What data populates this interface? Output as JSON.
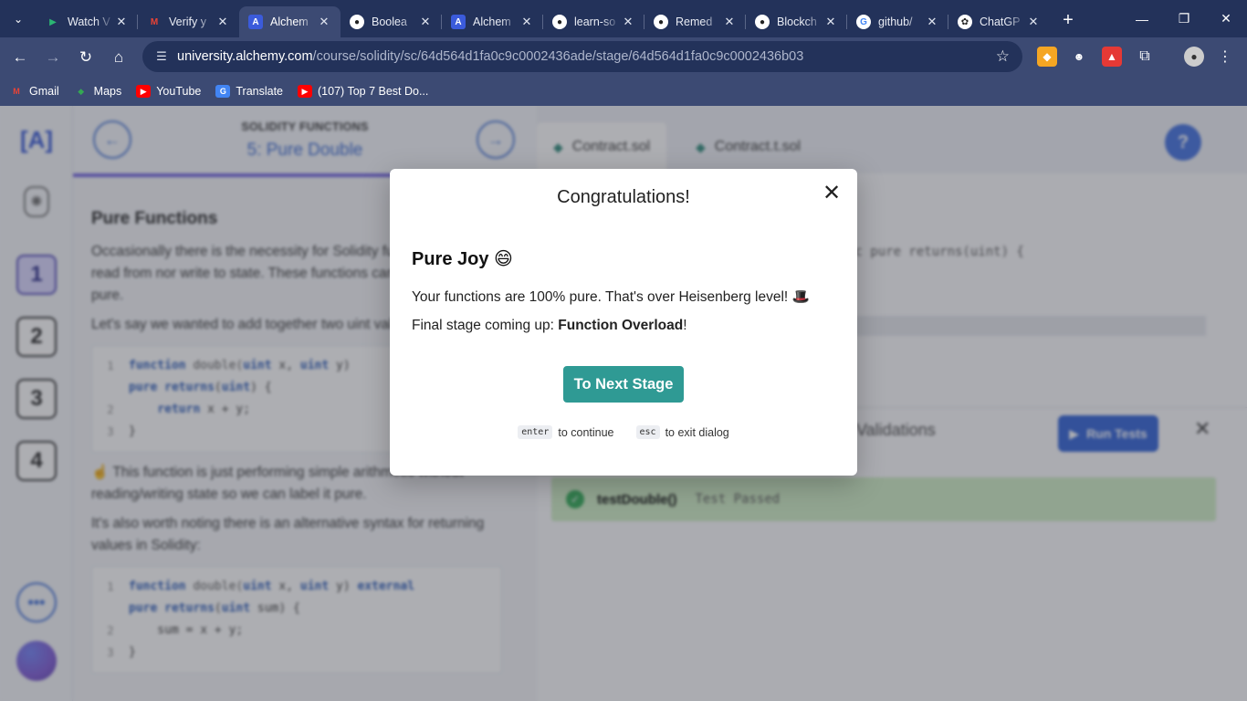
{
  "browser": {
    "tabs": [
      {
        "label": "Watch V",
        "favicon": "play-icon",
        "color": "#2bb673"
      },
      {
        "label": "Verify y",
        "favicon": "gmail-icon",
        "color": "#ea4335"
      },
      {
        "label": "Alchem",
        "favicon": "alchemy-icon",
        "color": "#3b5bdb",
        "active": true
      },
      {
        "label": "Boolea",
        "favicon": "discord-icon",
        "color": "#ffffff"
      },
      {
        "label": "Alchem",
        "favicon": "alchemy-icon",
        "color": "#3b5bdb"
      },
      {
        "label": "learn-so",
        "favicon": "github-icon",
        "color": "#ffffff"
      },
      {
        "label": "Remed",
        "favicon": "github-icon",
        "color": "#ffffff"
      },
      {
        "label": "Blockch",
        "favicon": "github-icon",
        "color": "#ffffff"
      },
      {
        "label": "github/",
        "favicon": "google-icon",
        "color": "#ffffff"
      },
      {
        "label": "ChatGP",
        "favicon": "chatgpt-icon",
        "color": "#ffffff"
      }
    ],
    "url_domain": "university.alchemy.com",
    "url_path": "/course/solidity/sc/64d564d1fa0c9c0002436ade/stage/64d564d1fa0c9c0002436b03",
    "bookmarks": [
      {
        "label": "Gmail",
        "icon": "gmail-icon",
        "color": "#ea4335"
      },
      {
        "label": "Maps",
        "icon": "maps-icon",
        "color": "#34a853"
      },
      {
        "label": "YouTube",
        "icon": "youtube-icon",
        "color": "#ff0000"
      },
      {
        "label": "Translate",
        "icon": "translate-icon",
        "color": "#4285f4"
      },
      {
        "label": "(107) Top 7 Best Do...",
        "icon": "youtube-icon",
        "color": "#ff0000"
      }
    ]
  },
  "lesson": {
    "section": "SOLIDITY FUNCTIONS",
    "title": "5: Pure Double",
    "heading": "Pure Functions",
    "p1": "Occasionally there is the necessity for Solidity functions to neither read from nor write to state. These functions can be labeled as pure.",
    "p2": "Let's say we wanted to add together two uint values:",
    "p3": "☝️ This function is just performing simple arithmetic without reading/writing state so we can label it pure.",
    "p4": "It's also worth noting there is an alternative syntax for returning values in Solidity:",
    "stages": [
      "1",
      "2",
      "3",
      "4"
    ]
  },
  "editor": {
    "tabs": [
      "Contract.sol",
      "Contract.t.sol"
    ],
    "code_fragment": "ic pure returns(uint) {",
    "validations_label": "Validations",
    "run_tests_label": "Run Tests",
    "test_name": "testDouble()",
    "test_status": "Test Passed"
  },
  "modal": {
    "title": "Congratulations!",
    "heading": "Pure Joy 😄",
    "message": "Your functions are 100% pure. That's over Heisenberg level! 🎩",
    "next_prefix": "Final stage coming up: ",
    "next_stage": "Function Overload",
    "next_suffix": "!",
    "button_label": "To Next Stage",
    "hint_enter_key": "enter",
    "hint_enter_text": "to continue",
    "hint_esc_key": "esc",
    "hint_esc_text": "to exit dialog"
  }
}
